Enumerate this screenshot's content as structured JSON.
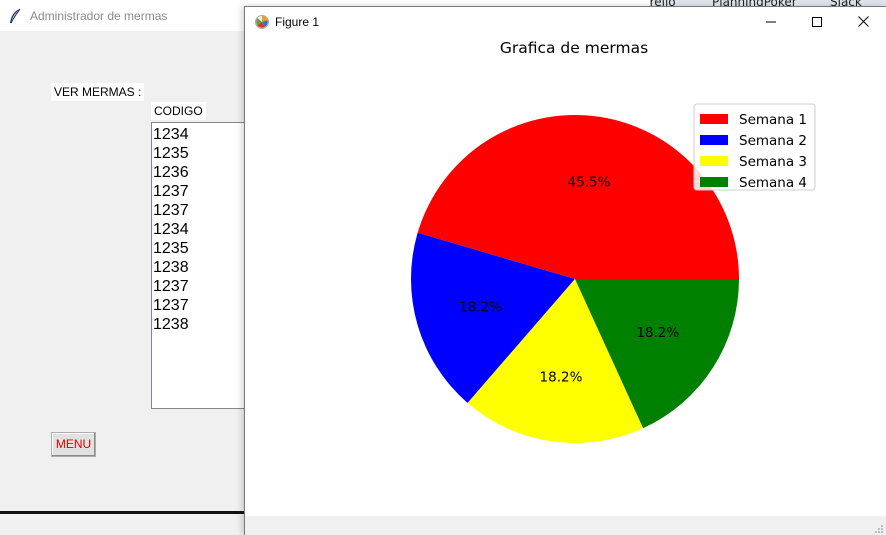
{
  "background_taskbar": {
    "items": [
      "Trello",
      "PlanningPoker",
      "Slack"
    ]
  },
  "admin_window": {
    "title": "Administrador de mermas",
    "ver_mermas_label": "VER MERMAS :",
    "codigo_header": "CODIGO",
    "codes": [
      "1234",
      "1235",
      "1236",
      "1237",
      "1237",
      "1234",
      "1235",
      "1238",
      "1237",
      "1237",
      "1238"
    ],
    "menu_button": "MENU",
    "menu_button_color": "#e00000",
    "icon": "feather-icon"
  },
  "figure_window": {
    "title": "Figure 1",
    "icon": "matplotlib-figure-icon",
    "controls": [
      "minimize-icon",
      "maximize-icon",
      "close-icon"
    ]
  },
  "chart_data": {
    "type": "pie",
    "title": "Grafica de mermas",
    "labels": [
      "Semana 1",
      "Semana 2",
      "Semana 3",
      "Semana 4"
    ],
    "values": [
      45.5,
      18.2,
      18.2,
      18.2
    ],
    "value_labels": [
      "45.5%",
      "18.2%",
      "18.2%",
      "18.2%"
    ],
    "colors": [
      "#ff0000",
      "#0000ff",
      "#ffff00",
      "#008000"
    ],
    "start_angle_deg": 0,
    "direction": "counterclockwise",
    "legend_position": "upper-right"
  }
}
